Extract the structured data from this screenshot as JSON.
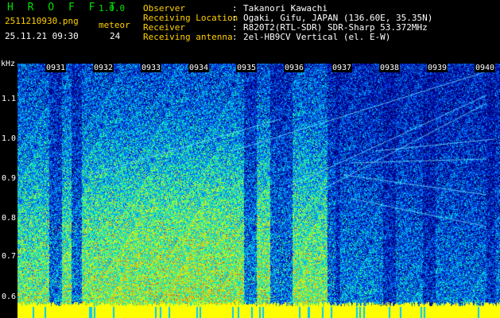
{
  "header": {
    "app_title": "H R O F F T",
    "version": "1.0.0",
    "file_name": "2511210930.png",
    "date_time": "25.11.21 09:30",
    "meteor_label": "meteor",
    "meteor_count": "24"
  },
  "info": [
    {
      "label": "Observer",
      "sep": ":",
      "value": "Takanori Kawachi"
    },
    {
      "label": "Receiving Location",
      "sep": ":",
      "value": "Ogaki, Gifu, JAPAN (136.60E, 35.35N)"
    },
    {
      "label": "Receiver",
      "sep": ":",
      "value": "R820T2(RTL-SDR) SDR-Sharp 53.372MHz"
    },
    {
      "label": "Receiving antenna",
      "sep": ":",
      "value": "2el-HB9CV Vertical (el. E-W)"
    }
  ],
  "axis": {
    "y_unit": "kHz",
    "y_ticks": [
      "1.1",
      "1.0",
      "0.9",
      "0.8",
      "0.7",
      "0.6"
    ],
    "x_ticks": [
      "0931",
      "0932",
      "0933",
      "0934",
      "0935",
      "0936",
      "0937",
      "0938",
      "0939",
      "0940"
    ]
  },
  "colors": {
    "title_green": "#00e000",
    "label_yellow": "#ffd000",
    "noise_floor": "#ffff00"
  }
}
